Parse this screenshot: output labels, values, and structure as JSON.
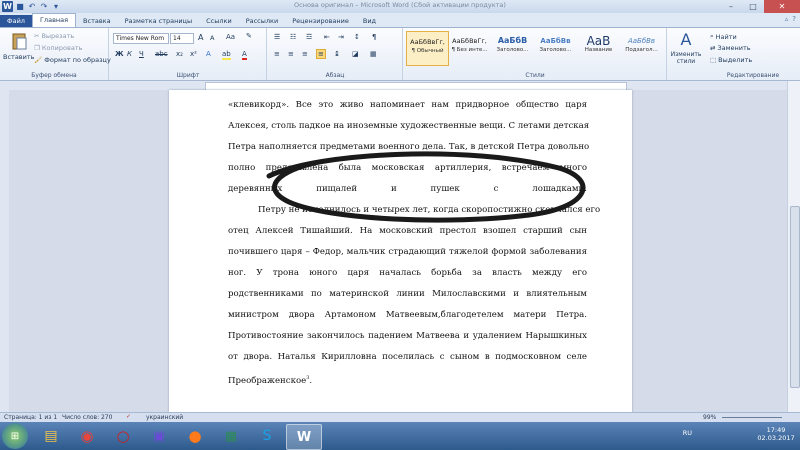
{
  "window": {
    "title": "Основа оригинал  –  Microsoft Word (Сбой активации продукта)"
  },
  "tabs": [
    "Файл",
    "Главная",
    "Вставка",
    "Разметка страницы",
    "Ссылки",
    "Рассылки",
    "Рецензирование",
    "Вид"
  ],
  "clipboard": {
    "paste": "Вставить",
    "cut": "Вырезать",
    "copy": "Копировать",
    "format_painter": "Формат по образцу",
    "label": "Буфер обмена"
  },
  "font": {
    "name": "Times New Rom",
    "size": "14",
    "bold": "Ж",
    "italic": "К",
    "underline": "Ч",
    "grow": "A",
    "shrink": "A",
    "case": "Aa",
    "label": "Шрифт"
  },
  "paragraph": {
    "label": "Абзац",
    "pilcrow": "¶"
  },
  "styles": {
    "label": "Стили",
    "items": [
      {
        "preview": "АаБбВвГг,",
        "name": "¶ Обычный"
      },
      {
        "preview": "АаБбВвГг,",
        "name": "¶ Без инте..."
      },
      {
        "preview": "АаБбВ",
        "name": "Заголово..."
      },
      {
        "preview": "АаБбВв",
        "name": "Заголово..."
      },
      {
        "preview": "АаВ",
        "name": "Название"
      },
      {
        "preview": "АаБбВв",
        "name": "Подзагол..."
      }
    ],
    "change": "Изменить стили"
  },
  "editing": {
    "find": "Найти",
    "replace": "Заменить",
    "select": "Выделить",
    "label": "Редактирование"
  },
  "document": {
    "lines": [
      "«клевикорд». Все это живо напоминает нам придворное общество царя",
      "Алексея, столь падкое на иноземные художественные вещи. С летами детская",
      "Петра наполняется предметами военного дела. Так, в детской Петра довольно",
      "полно представлена была московская артиллерия, встречаем много",
      "деревянных пищалей и пушек с лошадками.",
      "Петру не исполнилось и четырех лет, когда скоропостижно скончался его",
      "отец Алексей Тишайший. На московский престол взошел старший сын",
      "почившего царя – Федор, мальчик страдающий тяжелой формой заболевания",
      "ног. У трона юного царя началась борьба за власть между его",
      "родственниками по материнской линии Милославскими и влиятельным",
      "министром двора Артамоном Матвеевым,благодетелем матери Петра.",
      "Противостояние закончилось падением Матвеева и удалением Нарышкиных",
      "от двора. Наталья Кирилловна поселилась с сыном в подмосковном селе",
      "Преображенское"
    ],
    "footnote_ref": "3",
    "trailing": "."
  },
  "status": {
    "page": "Страница: 1 из 1",
    "words": "Число слов: 270",
    "language": "украинский",
    "zoom": "99%"
  },
  "tray": {
    "lang": "RU",
    "time": "17:49",
    "date": "02.03.2017"
  }
}
